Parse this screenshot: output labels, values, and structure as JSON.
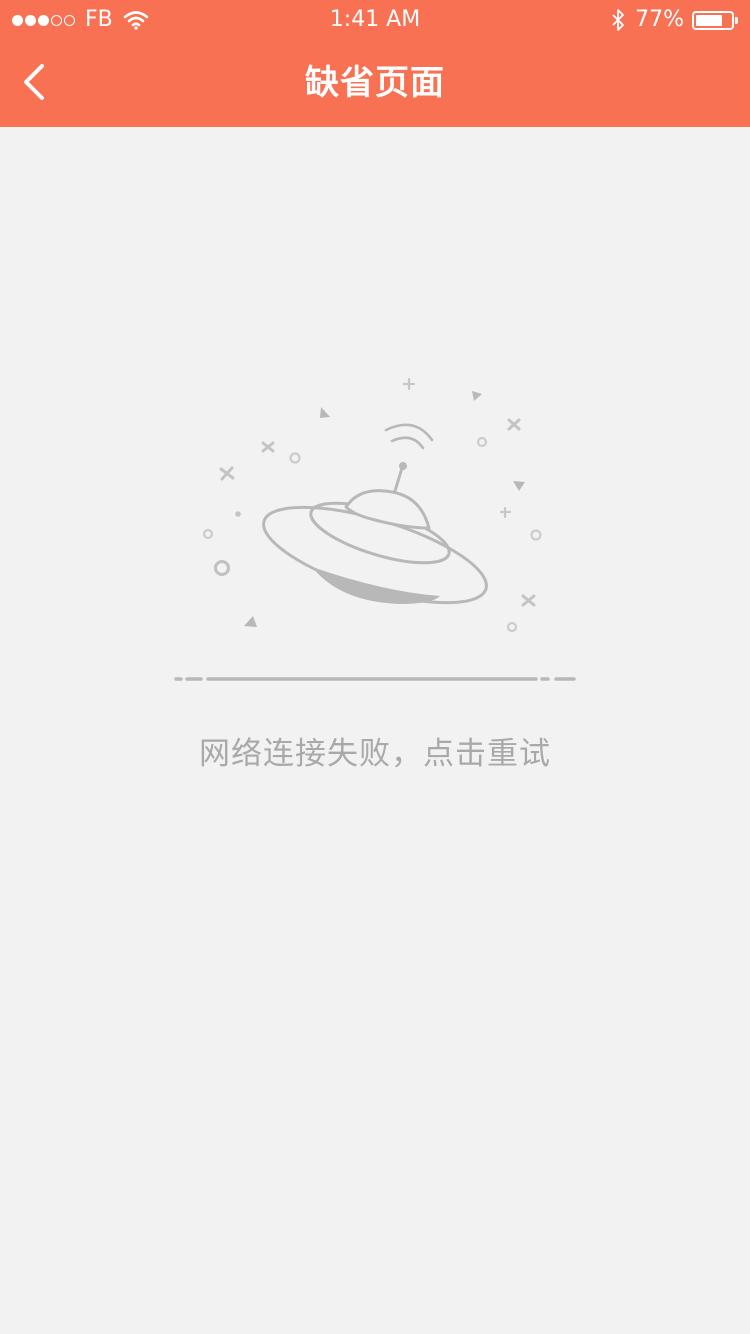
{
  "status_bar": {
    "signal_dots": [
      true,
      true,
      true,
      false,
      false
    ],
    "carrier": "FB",
    "time": "1:41 AM",
    "battery_percent": "77%",
    "battery_level": 0.77,
    "icons": [
      "wifi-icon",
      "bluetooth-icon",
      "battery-icon"
    ]
  },
  "nav": {
    "title": "缺省页面",
    "back_icon": "chevron-left-icon"
  },
  "empty_state": {
    "illustration": "ufo-icon",
    "message": "网络连接失败，点击重试"
  },
  "colors": {
    "header": "#f97153",
    "background": "#f2f2f2",
    "illustration": "#b8b8b8",
    "message": "#a9a9a9"
  }
}
